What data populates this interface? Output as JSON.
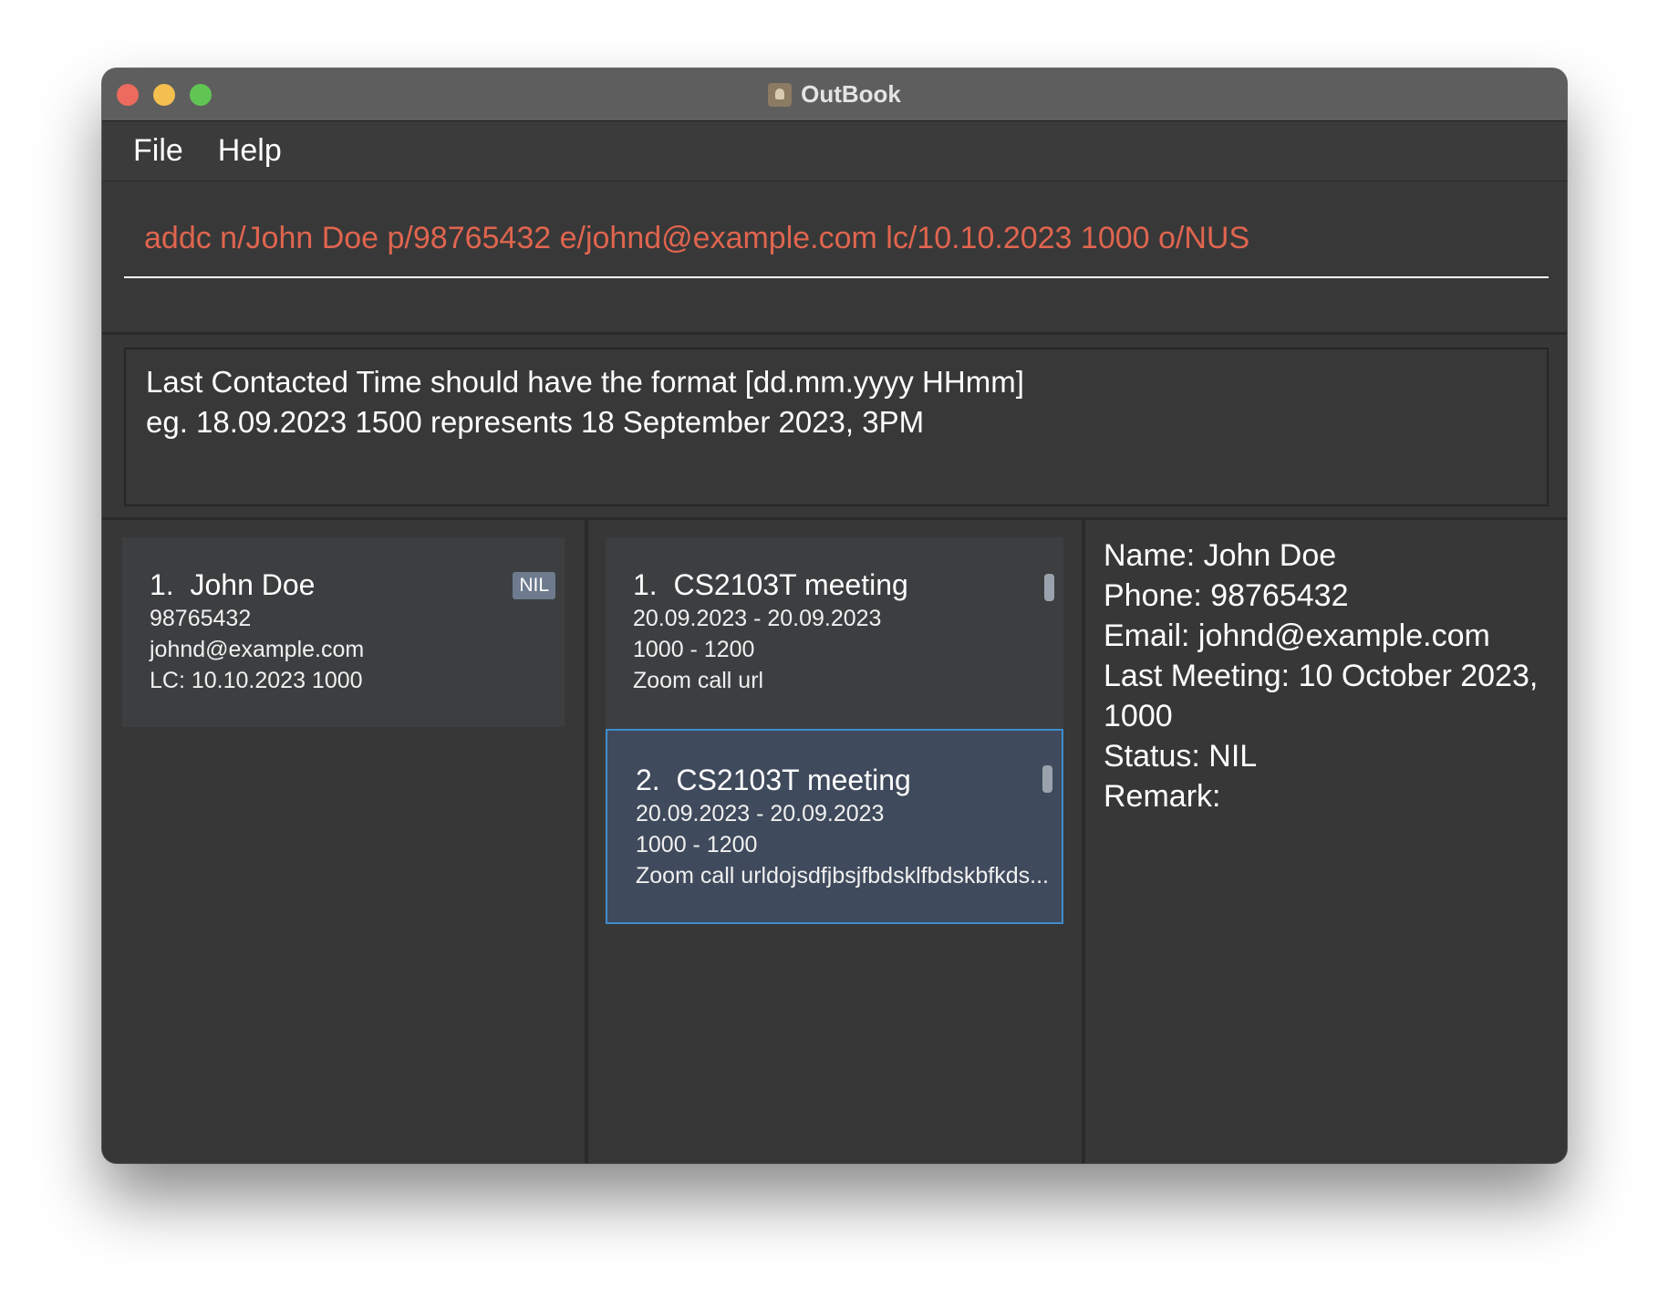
{
  "window": {
    "title": "OutBook"
  },
  "menu": {
    "file": "File",
    "help": "Help"
  },
  "command": {
    "value": "addc n/John Doe p/98765432 e/johnd@example.com lc/10.10.2023 1000 o/NUS"
  },
  "result": {
    "line1": "Last Contacted Time should have the format [dd.mm.yyyy HHmm]",
    "line2": "eg. 18.09.2023 1500 represents 18 September 2023, 3PM"
  },
  "persons": [
    {
      "index": "1.",
      "name": "John Doe",
      "tag": "NIL",
      "phone": "98765432",
      "email": "johnd@example.com",
      "last_contacted": "LC: 10.10.2023 1000"
    }
  ],
  "meetings": [
    {
      "index": "1.",
      "title": "CS2103T meeting",
      "dates": "20.09.2023  -  20.09.2023",
      "times": "1000  -  1200",
      "location": "Zoom call url",
      "selected": false
    },
    {
      "index": "2.",
      "title": "CS2103T meeting",
      "dates": "20.09.2023  -  20.09.2023",
      "times": "1000  -  1200",
      "location": "Zoom call urldojsdfjbsjfbdsklfbdskbfkds...",
      "selected": true
    }
  ],
  "details": {
    "name": "Name: John Doe",
    "phone": "Phone: 98765432",
    "email": "Email: johnd@example.com",
    "last_meeting": "Last Meeting: 10 October 2023, 1000",
    "status": "Status: NIL",
    "remark": "Remark:"
  },
  "colors": {
    "background": "#373737",
    "command_text": "#e0654f",
    "selected_card": "#3f4a5c",
    "selected_border": "#3e8ccb",
    "tag": "#6e7b8e"
  }
}
